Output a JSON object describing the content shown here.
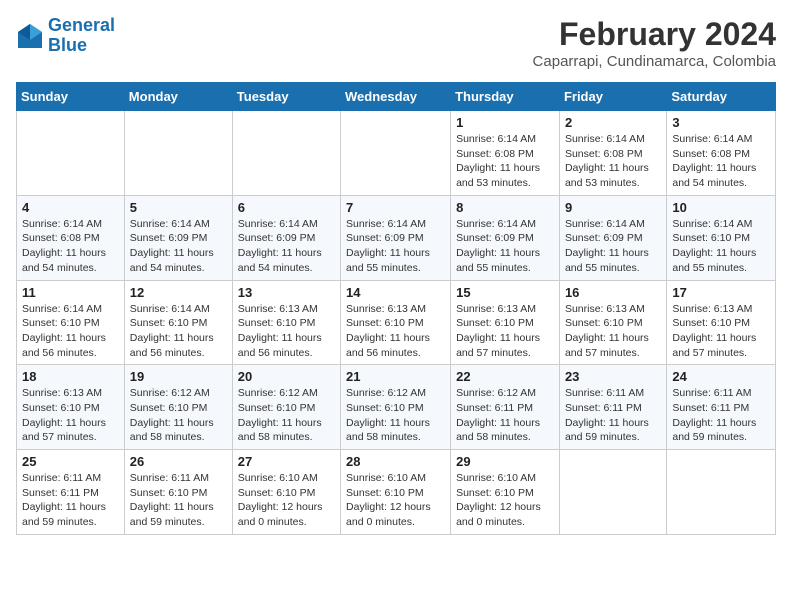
{
  "header": {
    "logo_line1": "General",
    "logo_line2": "Blue",
    "month": "February 2024",
    "location": "Caparrapi, Cundinamarca, Colombia"
  },
  "weekdays": [
    "Sunday",
    "Monday",
    "Tuesday",
    "Wednesday",
    "Thursday",
    "Friday",
    "Saturday"
  ],
  "weeks": [
    [
      {
        "day": "",
        "info": ""
      },
      {
        "day": "",
        "info": ""
      },
      {
        "day": "",
        "info": ""
      },
      {
        "day": "",
        "info": ""
      },
      {
        "day": "1",
        "info": "Sunrise: 6:14 AM\nSunset: 6:08 PM\nDaylight: 11 hours\nand 53 minutes."
      },
      {
        "day": "2",
        "info": "Sunrise: 6:14 AM\nSunset: 6:08 PM\nDaylight: 11 hours\nand 53 minutes."
      },
      {
        "day": "3",
        "info": "Sunrise: 6:14 AM\nSunset: 6:08 PM\nDaylight: 11 hours\nand 54 minutes."
      }
    ],
    [
      {
        "day": "4",
        "info": "Sunrise: 6:14 AM\nSunset: 6:08 PM\nDaylight: 11 hours\nand 54 minutes."
      },
      {
        "day": "5",
        "info": "Sunrise: 6:14 AM\nSunset: 6:09 PM\nDaylight: 11 hours\nand 54 minutes."
      },
      {
        "day": "6",
        "info": "Sunrise: 6:14 AM\nSunset: 6:09 PM\nDaylight: 11 hours\nand 54 minutes."
      },
      {
        "day": "7",
        "info": "Sunrise: 6:14 AM\nSunset: 6:09 PM\nDaylight: 11 hours\nand 55 minutes."
      },
      {
        "day": "8",
        "info": "Sunrise: 6:14 AM\nSunset: 6:09 PM\nDaylight: 11 hours\nand 55 minutes."
      },
      {
        "day": "9",
        "info": "Sunrise: 6:14 AM\nSunset: 6:09 PM\nDaylight: 11 hours\nand 55 minutes."
      },
      {
        "day": "10",
        "info": "Sunrise: 6:14 AM\nSunset: 6:10 PM\nDaylight: 11 hours\nand 55 minutes."
      }
    ],
    [
      {
        "day": "11",
        "info": "Sunrise: 6:14 AM\nSunset: 6:10 PM\nDaylight: 11 hours\nand 56 minutes."
      },
      {
        "day": "12",
        "info": "Sunrise: 6:14 AM\nSunset: 6:10 PM\nDaylight: 11 hours\nand 56 minutes."
      },
      {
        "day": "13",
        "info": "Sunrise: 6:13 AM\nSunset: 6:10 PM\nDaylight: 11 hours\nand 56 minutes."
      },
      {
        "day": "14",
        "info": "Sunrise: 6:13 AM\nSunset: 6:10 PM\nDaylight: 11 hours\nand 56 minutes."
      },
      {
        "day": "15",
        "info": "Sunrise: 6:13 AM\nSunset: 6:10 PM\nDaylight: 11 hours\nand 57 minutes."
      },
      {
        "day": "16",
        "info": "Sunrise: 6:13 AM\nSunset: 6:10 PM\nDaylight: 11 hours\nand 57 minutes."
      },
      {
        "day": "17",
        "info": "Sunrise: 6:13 AM\nSunset: 6:10 PM\nDaylight: 11 hours\nand 57 minutes."
      }
    ],
    [
      {
        "day": "18",
        "info": "Sunrise: 6:13 AM\nSunset: 6:10 PM\nDaylight: 11 hours\nand 57 minutes."
      },
      {
        "day": "19",
        "info": "Sunrise: 6:12 AM\nSunset: 6:10 PM\nDaylight: 11 hours\nand 58 minutes."
      },
      {
        "day": "20",
        "info": "Sunrise: 6:12 AM\nSunset: 6:10 PM\nDaylight: 11 hours\nand 58 minutes."
      },
      {
        "day": "21",
        "info": "Sunrise: 6:12 AM\nSunset: 6:10 PM\nDaylight: 11 hours\nand 58 minutes."
      },
      {
        "day": "22",
        "info": "Sunrise: 6:12 AM\nSunset: 6:11 PM\nDaylight: 11 hours\nand 58 minutes."
      },
      {
        "day": "23",
        "info": "Sunrise: 6:11 AM\nSunset: 6:11 PM\nDaylight: 11 hours\nand 59 minutes."
      },
      {
        "day": "24",
        "info": "Sunrise: 6:11 AM\nSunset: 6:11 PM\nDaylight: 11 hours\nand 59 minutes."
      }
    ],
    [
      {
        "day": "25",
        "info": "Sunrise: 6:11 AM\nSunset: 6:11 PM\nDaylight: 11 hours\nand 59 minutes."
      },
      {
        "day": "26",
        "info": "Sunrise: 6:11 AM\nSunset: 6:10 PM\nDaylight: 11 hours\nand 59 minutes."
      },
      {
        "day": "27",
        "info": "Sunrise: 6:10 AM\nSunset: 6:10 PM\nDaylight: 12 hours\nand 0 minutes."
      },
      {
        "day": "28",
        "info": "Sunrise: 6:10 AM\nSunset: 6:10 PM\nDaylight: 12 hours\nand 0 minutes."
      },
      {
        "day": "29",
        "info": "Sunrise: 6:10 AM\nSunset: 6:10 PM\nDaylight: 12 hours\nand 0 minutes."
      },
      {
        "day": "",
        "info": ""
      },
      {
        "day": "",
        "info": ""
      }
    ]
  ]
}
